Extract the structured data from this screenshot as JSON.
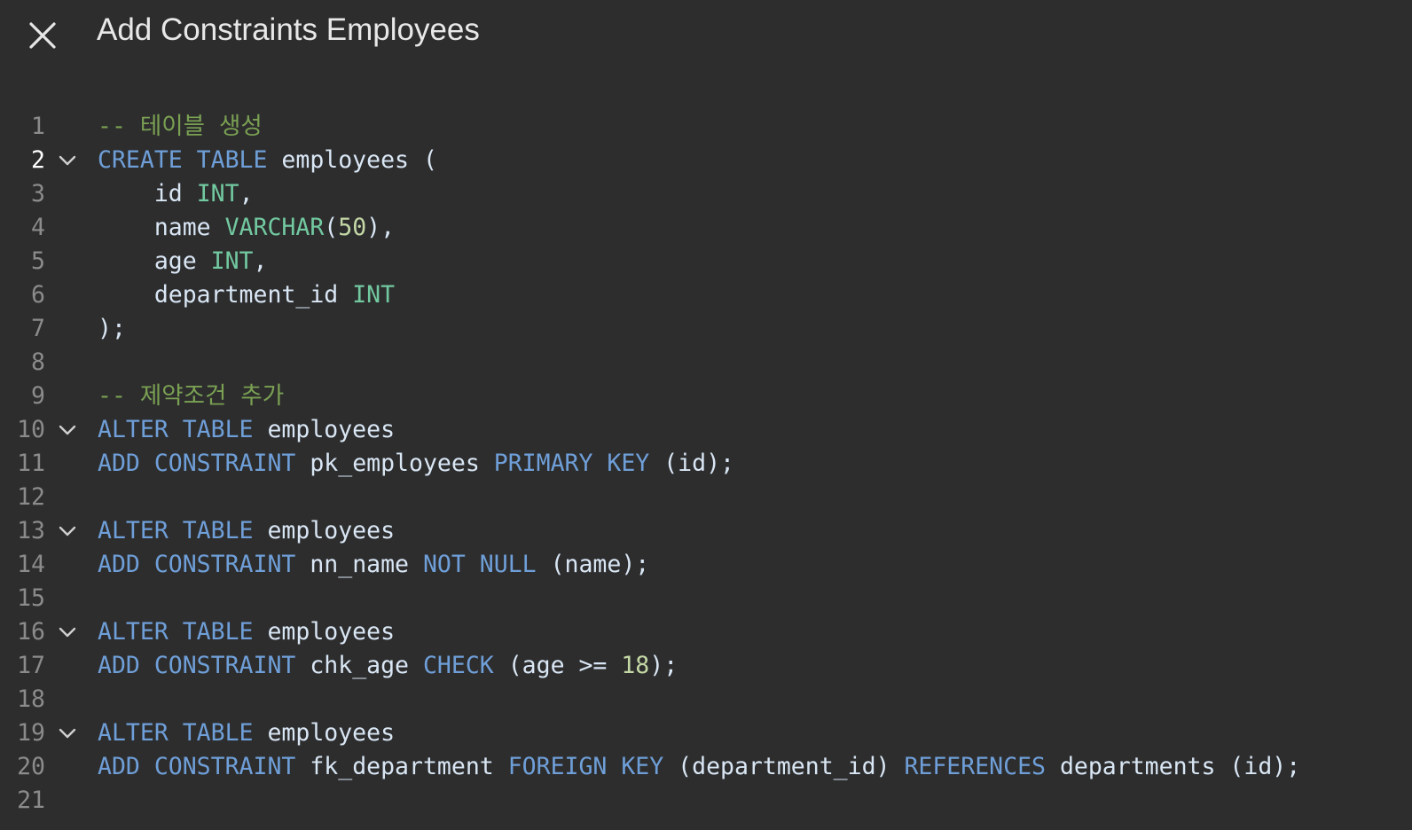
{
  "header": {
    "title": "Add Constraints Employees",
    "close_icon": "close-icon"
  },
  "colors": {
    "background": "#2d2d2e",
    "comment": "#7aa152",
    "keyword": "#6f9fd8",
    "type": "#72c9a0",
    "number": "#c4d8a6",
    "identifier": "#d9e6f4",
    "line_number": "#8b8b8b",
    "active_line_number": "#ffffff"
  },
  "editor": {
    "active_line": 2,
    "fold_icon": "chevron-down-icon",
    "lines": [
      {
        "number": "1",
        "fold": false,
        "tokens": [
          {
            "t": "comment",
            "text": "-- 테이블 생성"
          }
        ]
      },
      {
        "number": "2",
        "fold": true,
        "tokens": [
          {
            "t": "keyword",
            "text": "CREATE TABLE"
          },
          {
            "t": "ident",
            "text": " employees "
          },
          {
            "t": "punct",
            "text": "("
          }
        ]
      },
      {
        "number": "3",
        "fold": false,
        "tokens": [
          {
            "t": "ident",
            "text": "    id "
          },
          {
            "t": "type",
            "text": "INT"
          },
          {
            "t": "punct",
            "text": ","
          }
        ]
      },
      {
        "number": "4",
        "fold": false,
        "tokens": [
          {
            "t": "ident",
            "text": "    name "
          },
          {
            "t": "type",
            "text": "VARCHAR"
          },
          {
            "t": "punct",
            "text": "("
          },
          {
            "t": "number",
            "text": "50"
          },
          {
            "t": "punct",
            "text": "),"
          }
        ]
      },
      {
        "number": "5",
        "fold": false,
        "tokens": [
          {
            "t": "ident",
            "text": "    age "
          },
          {
            "t": "type",
            "text": "INT"
          },
          {
            "t": "punct",
            "text": ","
          }
        ]
      },
      {
        "number": "6",
        "fold": false,
        "tokens": [
          {
            "t": "ident",
            "text": "    department_id "
          },
          {
            "t": "type",
            "text": "INT"
          }
        ]
      },
      {
        "number": "7",
        "fold": false,
        "tokens": [
          {
            "t": "punct",
            "text": ");"
          }
        ]
      },
      {
        "number": "8",
        "fold": false,
        "tokens": []
      },
      {
        "number": "9",
        "fold": false,
        "tokens": [
          {
            "t": "comment",
            "text": "-- 제약조건 추가"
          }
        ]
      },
      {
        "number": "10",
        "fold": true,
        "tokens": [
          {
            "t": "keyword",
            "text": "ALTER TABLE"
          },
          {
            "t": "ident",
            "text": " employees"
          }
        ]
      },
      {
        "number": "11",
        "fold": false,
        "tokens": [
          {
            "t": "keyword",
            "text": "ADD CONSTRAINT"
          },
          {
            "t": "ident",
            "text": " pk_employees "
          },
          {
            "t": "keyword",
            "text": "PRIMARY KEY"
          },
          {
            "t": "punct",
            "text": " (id);"
          }
        ]
      },
      {
        "number": "12",
        "fold": false,
        "tokens": []
      },
      {
        "number": "13",
        "fold": true,
        "tokens": [
          {
            "t": "keyword",
            "text": "ALTER TABLE"
          },
          {
            "t": "ident",
            "text": " employees"
          }
        ]
      },
      {
        "number": "14",
        "fold": false,
        "tokens": [
          {
            "t": "keyword",
            "text": "ADD CONSTRAINT"
          },
          {
            "t": "ident",
            "text": " nn_name "
          },
          {
            "t": "keyword",
            "text": "NOT NULL"
          },
          {
            "t": "punct",
            "text": " (name);"
          }
        ]
      },
      {
        "number": "15",
        "fold": false,
        "tokens": []
      },
      {
        "number": "16",
        "fold": true,
        "tokens": [
          {
            "t": "keyword",
            "text": "ALTER TABLE"
          },
          {
            "t": "ident",
            "text": " employees"
          }
        ]
      },
      {
        "number": "17",
        "fold": false,
        "tokens": [
          {
            "t": "keyword",
            "text": "ADD CONSTRAINT"
          },
          {
            "t": "ident",
            "text": " chk_age "
          },
          {
            "t": "keyword",
            "text": "CHECK"
          },
          {
            "t": "punct",
            "text": " (age >= "
          },
          {
            "t": "number",
            "text": "18"
          },
          {
            "t": "punct",
            "text": ");"
          }
        ]
      },
      {
        "number": "18",
        "fold": false,
        "tokens": []
      },
      {
        "number": "19",
        "fold": true,
        "tokens": [
          {
            "t": "keyword",
            "text": "ALTER TABLE"
          },
          {
            "t": "ident",
            "text": " employees"
          }
        ]
      },
      {
        "number": "20",
        "fold": false,
        "tokens": [
          {
            "t": "keyword",
            "text": "ADD CONSTRAINT"
          },
          {
            "t": "ident",
            "text": " fk_department "
          },
          {
            "t": "keyword",
            "text": "FOREIGN KEY"
          },
          {
            "t": "punct",
            "text": " (department_id) "
          },
          {
            "t": "keyword",
            "text": "REFERENCES"
          },
          {
            "t": "ident",
            "text": " departments "
          },
          {
            "t": "punct",
            "text": "(id);"
          }
        ]
      },
      {
        "number": "21",
        "fold": false,
        "tokens": []
      }
    ]
  }
}
